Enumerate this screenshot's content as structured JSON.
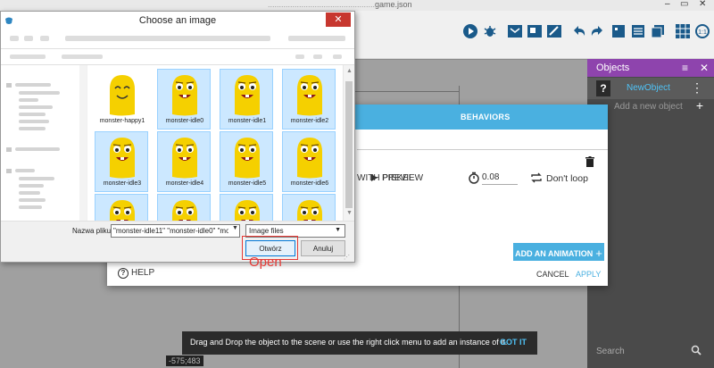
{
  "app": {
    "window_title": "game.json"
  },
  "objects_panel": {
    "title": "Objects",
    "object_name": "NewObject",
    "add_new": "Add a new object",
    "search_placeholder": "Search"
  },
  "coordinates": "-575;483",
  "object_editor": {
    "tab_behaviors": "BEHAVIORS",
    "edit_with_piskel": "WITH PISKEL",
    "preview_label": "PREVIEW",
    "timer_value": "0.08",
    "loop_label": "Don't loop",
    "add_animation": "ADD AN ANIMATION",
    "help": "HELP",
    "cancel": "CANCEL",
    "apply": "APPLY"
  },
  "snackbar": {
    "message": "Drag and Drop the object to the scene or use the right click menu to add an instance of it.",
    "action": "GOT IT"
  },
  "file_dialog": {
    "title": "Choose an image",
    "close_symbol": "✕",
    "files": [
      {
        "name": "monster-happy1",
        "selected": false,
        "face": "happy"
      },
      {
        "name": "monster-idle0",
        "selected": true,
        "face": "idle"
      },
      {
        "name": "monster-idle1",
        "selected": true,
        "face": "idle"
      },
      {
        "name": "monster-idle2",
        "selected": true,
        "face": "idle"
      },
      {
        "name": "monster-idle3",
        "selected": true,
        "face": "idle"
      },
      {
        "name": "monster-idle4",
        "selected": true,
        "face": "idle"
      },
      {
        "name": "monster-idle5",
        "selected": true,
        "face": "idle"
      },
      {
        "name": "monster-idle6",
        "selected": true,
        "face": "idle"
      },
      {
        "name": "",
        "selected": true,
        "face": "idle"
      },
      {
        "name": "",
        "selected": true,
        "face": "idle"
      },
      {
        "name": "",
        "selected": true,
        "face": "idle"
      },
      {
        "name": "",
        "selected": true,
        "face": "idle"
      }
    ],
    "filename_label": "Nazwa pliku:",
    "filename_value": "\"monster-idle11\" \"monster-idle0\" \"monste",
    "filetype": "Image files",
    "open_button": "Otwórz",
    "cancel_button": "Anuluj"
  },
  "annotation": {
    "text": "Open",
    "color": "#e53935"
  },
  "colors": {
    "accent": "#4ab0e0",
    "objects_header": "#8e44ad",
    "monster": "#f5d000"
  }
}
